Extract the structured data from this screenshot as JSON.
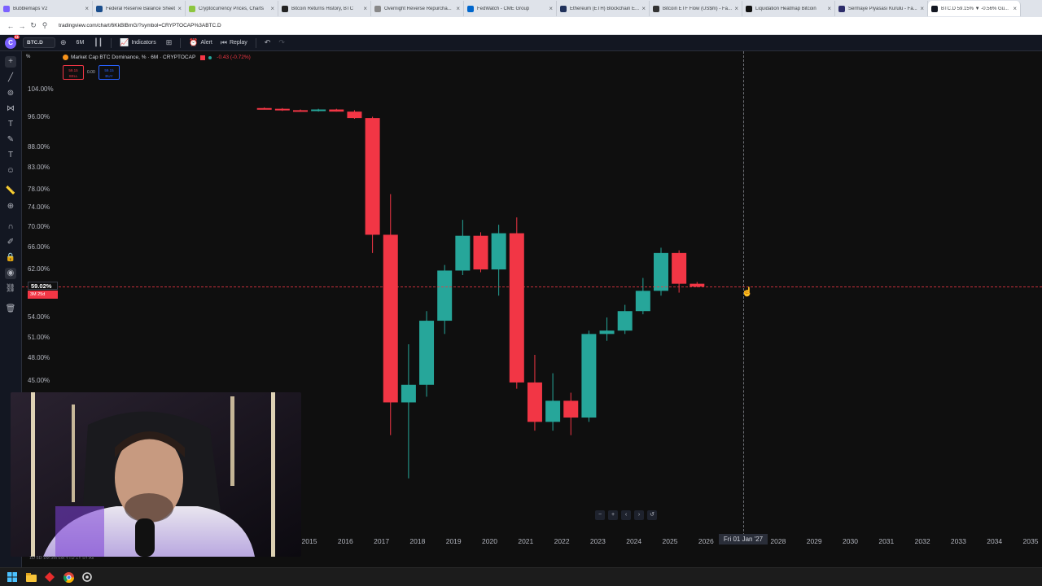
{
  "browser": {
    "tabs": [
      {
        "title": "Bubblemaps V2",
        "color": "#7b61ff"
      },
      {
        "title": "Federal Reserve Balance Sheet",
        "color": "#1a4d8c"
      },
      {
        "title": "Cryptocurrency Prices, Charts",
        "color": "#8dc63f"
      },
      {
        "title": "Bitcoin Returns History, BTC",
        "color": "#222222"
      },
      {
        "title": "Overnight Reverse Repurcha...",
        "color": "#888888"
      },
      {
        "title": "FedWatch - CME Group",
        "color": "#0066cc"
      },
      {
        "title": "Ethereum (ETH) Blockchain E...",
        "color": "#21325b"
      },
      {
        "title": "Bitcoin ETF Flow (US$m) - Fa...",
        "color": "#333333"
      },
      {
        "title": "Liquidation Heatmap Bitcoin",
        "color": "#111111"
      },
      {
        "title": "Sermaye Piyasası Kurulu - Fa...",
        "color": "#2d2d6a"
      },
      {
        "title": "BTC.D 59.15% ▼ -0.56% Gü...",
        "color": "#131722"
      }
    ],
    "active_tab": 10,
    "url": "tradingview.com/chart/6KkBlBmG/?symbol=CRYPTOCAP%3ABTC.D"
  },
  "toolbar": {
    "logo_badge": "11",
    "symbol": "BTC.D",
    "interval": "6M",
    "indicators_label": "Indicators",
    "alert_label": "Alert",
    "replay_label": "Replay"
  },
  "legend": {
    "pct": "%",
    "title": "Market Cap BTC Dominance, %  · 6M · CRYPTOCAP",
    "change": "-0.43 (-0.72%)",
    "sell_price": "59.15",
    "sell_label": "SELL",
    "spread": "0.00",
    "buy_price": "59.15",
    "buy_label": "BUY"
  },
  "price_tag": {
    "value": "59.02%",
    "sub": "3M 25d"
  },
  "date_tag": "Fri 01 Jan '27",
  "chart_data": {
    "type": "candlestick",
    "title": "Market Cap BTC Dominance, %",
    "interval": "6M",
    "y_scale": "log",
    "y_ticks": [
      "104.00%",
      "96.00%",
      "88.00%",
      "83.00%",
      "78.00%",
      "74.00%",
      "70.00%",
      "66.00%",
      "62.00%",
      "54.00%",
      "51.00%",
      "48.00%",
      "45.00%"
    ],
    "x_ticks": [
      "2015",
      "2016",
      "2017",
      "2018",
      "2019",
      "2020",
      "2021",
      "2022",
      "2023",
      "2024",
      "2025",
      "2026",
      "2028",
      "2029",
      "2030",
      "2031",
      "2032",
      "2033",
      "2034",
      "2035"
    ],
    "candles": [
      {
        "t": "2014-H1",
        "o": 98.6,
        "h": 98.8,
        "l": 98.2,
        "c": 98.4
      },
      {
        "t": "2014-H2",
        "o": 98.4,
        "h": 98.6,
        "l": 97.8,
        "c": 98.0
      },
      {
        "t": "2015-H1",
        "o": 98.0,
        "h": 98.2,
        "l": 97.6,
        "c": 97.8
      },
      {
        "t": "2015-H2",
        "o": 97.8,
        "h": 98.4,
        "l": 97.6,
        "c": 98.2
      },
      {
        "t": "2016-H1",
        "o": 98.2,
        "h": 98.4,
        "l": 97.6,
        "c": 97.6
      },
      {
        "t": "2016-H2",
        "o": 97.6,
        "h": 98.0,
        "l": 95.6,
        "c": 95.8
      },
      {
        "t": "2017-H1",
        "o": 95.8,
        "h": 96.2,
        "l": 65.0,
        "c": 68.5
      },
      {
        "t": "2017-H2",
        "o": 68.5,
        "h": 77.0,
        "l": 38.5,
        "c": 42.3
      },
      {
        "t": "2018-H1",
        "o": 42.3,
        "h": 50.0,
        "l": 34.0,
        "c": 44.5
      },
      {
        "t": "2018-H2",
        "o": 44.5,
        "h": 55.0,
        "l": 43.0,
        "c": 53.5
      },
      {
        "t": "2019-H1",
        "o": 53.5,
        "h": 62.8,
        "l": 51.5,
        "c": 61.8
      },
      {
        "t": "2019-H2",
        "o": 61.8,
        "h": 71.5,
        "l": 61.0,
        "c": 68.3
      },
      {
        "t": "2020-H1",
        "o": 68.3,
        "h": 69.0,
        "l": 61.5,
        "c": 62.0
      },
      {
        "t": "2020-H2",
        "o": 62.0,
        "h": 70.5,
        "l": 57.5,
        "c": 68.8
      },
      {
        "t": "2021-H1",
        "o": 68.8,
        "h": 72.0,
        "l": 44.0,
        "c": 44.8
      },
      {
        "t": "2021-H2",
        "o": 44.8,
        "h": 48.5,
        "l": 39.0,
        "c": 40.0
      },
      {
        "t": "2022-H1",
        "o": 40.0,
        "h": 46.0,
        "l": 39.0,
        "c": 42.5
      },
      {
        "t": "2022-H2",
        "o": 42.5,
        "h": 43.5,
        "l": 38.5,
        "c": 40.5
      },
      {
        "t": "2023-H1",
        "o": 40.5,
        "h": 52.0,
        "l": 40.0,
        "c": 51.5
      },
      {
        "t": "2023-H2",
        "o": 51.5,
        "h": 54.0,
        "l": 50.5,
        "c": 52.0
      },
      {
        "t": "2024-H1",
        "o": 52.0,
        "h": 56.0,
        "l": 51.5,
        "c": 55.0
      },
      {
        "t": "2024-H2",
        "o": 55.0,
        "h": 60.5,
        "l": 54.5,
        "c": 58.3
      },
      {
        "t": "2025-H1",
        "o": 58.3,
        "h": 66.0,
        "l": 57.5,
        "c": 65.0
      },
      {
        "t": "2025-H2",
        "o": 65.0,
        "h": 65.5,
        "l": 58.0,
        "c": 59.5
      },
      {
        "t": "2026-H1",
        "o": 59.5,
        "h": 59.8,
        "l": 58.9,
        "c": 59.02
      }
    ],
    "last_price": 59.02,
    "colors": {
      "up": "#26a69a",
      "down": "#f23645"
    }
  },
  "taskbar": {
    "icons": [
      "windows-icon",
      "folder-icon",
      "app-red-icon",
      "chrome-icon",
      "settings-icon"
    ]
  }
}
